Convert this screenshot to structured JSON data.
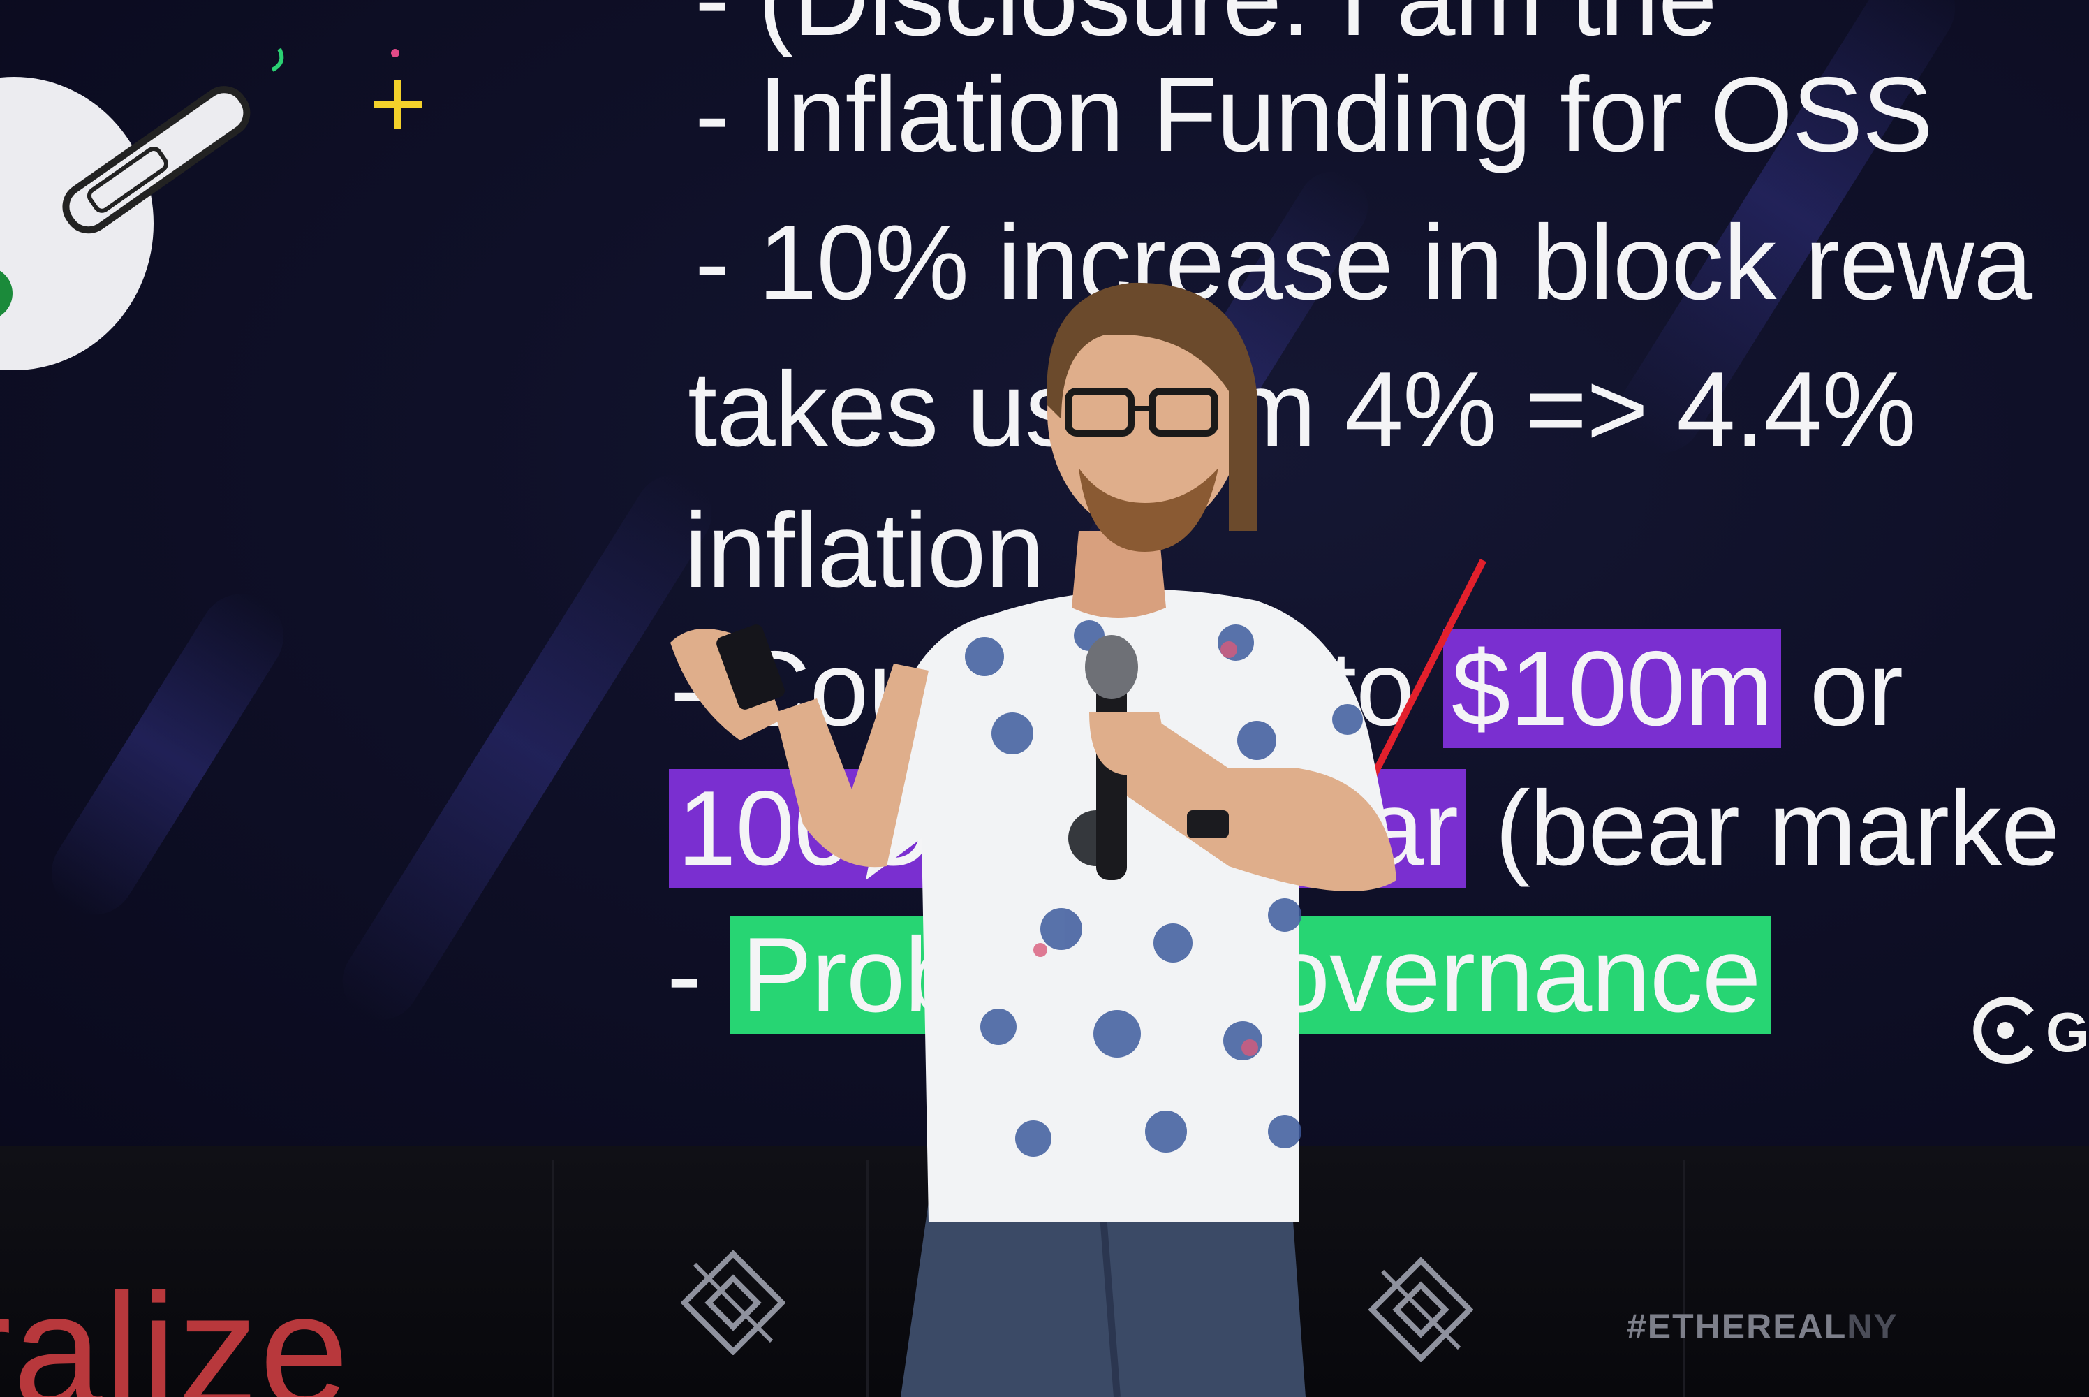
{
  "slide": {
    "lines": {
      "line1": "- (Disclosure: I am the ",
      "line2": "- Inflation Funding for OSS",
      "line3": "- 10% increase in block rewa",
      "line4": "takes us from 4% => 4.4%",
      "line5": "inflation",
      "line6a": "- Could be up to ",
      "line6b": "$100m",
      "line6c": " or",
      "line7a": "100Ok ETH/year",
      "line7b": " (bear marke",
      "line8a": "- ",
      "line8b": "Problem: Governance"
    },
    "highlight_colors": {
      "purple": "#7a2fd0",
      "green": "#27d573",
      "strike": "#e2202c"
    },
    "corner_logo_letter": "G"
  },
  "stage": {
    "brand_word": "ralize",
    "hashtag_main": "#ETHEREAL",
    "hashtag_suffix": "NY"
  },
  "icons": {
    "mascot": "robot-mascot-icon",
    "sparkle": "sparkle-icon",
    "stage_logo": "ethereal-diamond-logo",
    "slide_logo": "gitcoin-logo"
  }
}
